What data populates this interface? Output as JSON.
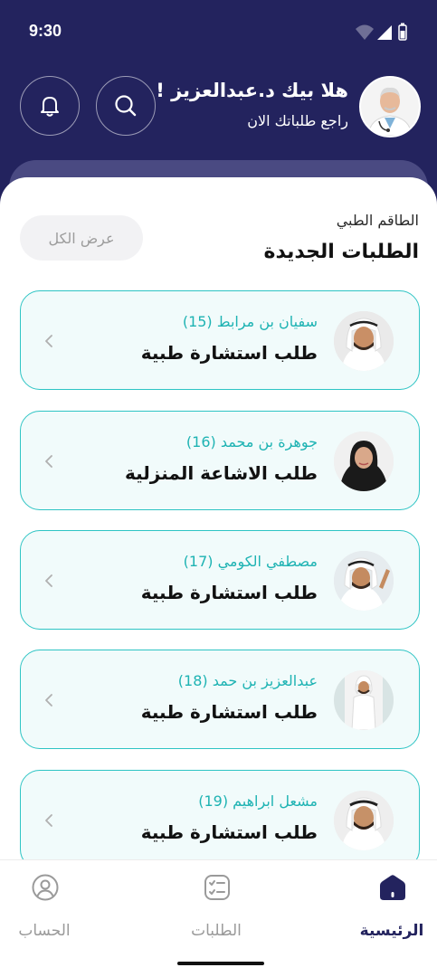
{
  "status_bar": {
    "time": "9:30"
  },
  "header": {
    "greeting": "هلا بيك د.عبدالعزيز !",
    "subtitle": "راجع طلباتك الان",
    "search_icon": "search-icon",
    "bell_icon": "bell-icon"
  },
  "section": {
    "subtitle": "الطاقم الطبي",
    "title": "الطلبات الجديدة",
    "view_all": "عرض الكل"
  },
  "requests": [
    {
      "name": "سفيان بن مرابط (15)",
      "type": "طلب استشارة طبية"
    },
    {
      "name": "جوهرة بن محمد (16)",
      "type": "طلب الاشاعة المنزلية"
    },
    {
      "name": "مصطفي الكومي  (17)",
      "type": "طلب استشارة طبية"
    },
    {
      "name": "عبدالعزيز بن حمد  (18)",
      "type": "طلب استشارة طبية"
    },
    {
      "name": "مشعل ابراهيم (19)",
      "type": "طلب استشارة طبية"
    }
  ],
  "bottom_nav": {
    "home": "الرئيسية",
    "orders": "الطلبات",
    "account": "الحساب"
  },
  "colors": {
    "primary": "#23235e",
    "accent": "#2ec4c4",
    "card_bg": "#f1fbfb",
    "inactive": "#9a9a9a"
  }
}
